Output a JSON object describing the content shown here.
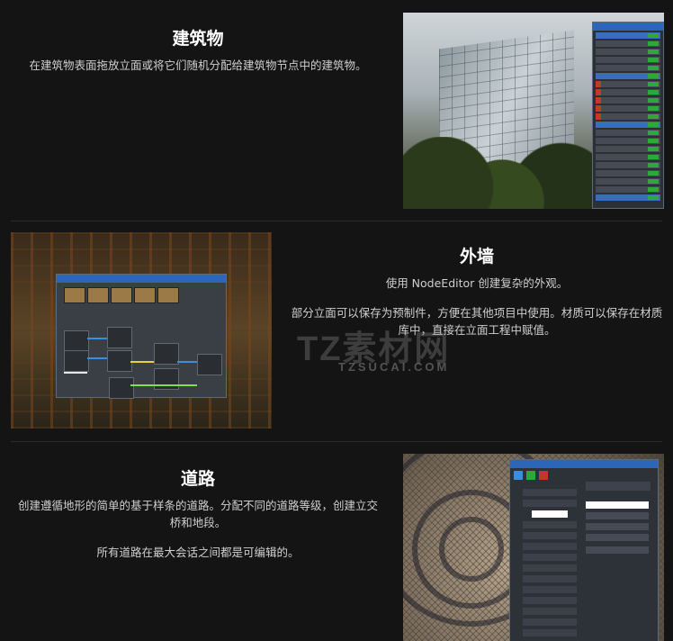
{
  "sections": [
    {
      "title": "建筑物",
      "paragraphs": [
        "在建筑物表面拖放立面或将它们随机分配给建筑物节点中的建筑物。"
      ]
    },
    {
      "title": "外墙",
      "paragraphs": [
        "使用 NodeEditor 创建复杂的外观。",
        "部分立面可以保存为预制件，方便在其他项目中使用。材质可以保存在材质库中，直接在立面工程中赋值。"
      ]
    },
    {
      "title": "道路",
      "paragraphs": [
        "创建遵循地形的简单的基于样条的道路。分配不同的道路等级，创建立交桥和地段。",
        "所有道路在最大会话之间都是可编辑的。"
      ]
    }
  ],
  "images": {
    "building": "building-facade-screenshot",
    "node_editor": "node-editor-screenshot",
    "road": "road-tool-screenshot"
  },
  "watermark": {
    "text": "TZ素材网",
    "url": "TZSUCAI.COM"
  }
}
